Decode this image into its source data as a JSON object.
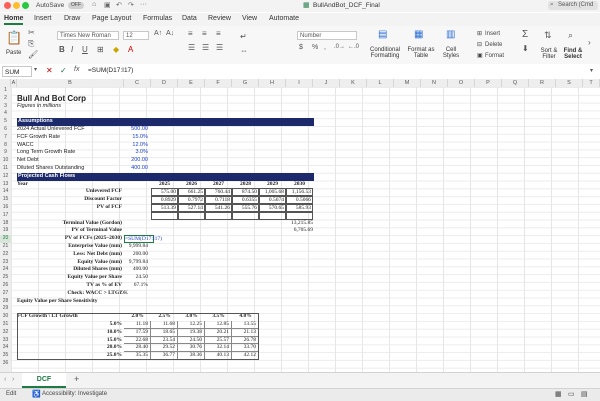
{
  "titlebar": {
    "autosave": "AutoSave",
    "autosave_state": "OFF",
    "filename": "BullAndBot_DCF_Final",
    "search": "Search (Cmd"
  },
  "tabs": [
    "Home",
    "Insert",
    "Draw",
    "Page Layout",
    "Formulas",
    "Data",
    "Review",
    "View",
    "Automate"
  ],
  "ribbon": {
    "paste": "Paste",
    "font_name": "Times New Roman",
    "font_size": "12",
    "number_format": "Number",
    "conditional_formatting": "Conditional Formatting",
    "format_as_table": "Format as Table",
    "cell_styles": "Cell Styles",
    "insert": "Insert",
    "delete": "Delete",
    "format": "Format",
    "sort_filter": "Sort & Filter",
    "find_select": "Find & Select"
  },
  "formula_bar": {
    "name_box": "SUM",
    "fx": "fx",
    "formula": "=SUM(D17:I17)"
  },
  "columns": [
    "A",
    "B",
    "C",
    "D",
    "E",
    "F",
    "G",
    "H",
    "I",
    "J",
    "K",
    "L",
    "M",
    "N",
    "O",
    "P",
    "Q",
    "R",
    "S",
    "T"
  ],
  "rows": [
    "1",
    "2",
    "3",
    "4",
    "5",
    "6",
    "7",
    "8",
    "9",
    "10",
    "11",
    "12",
    "13",
    "14",
    "15",
    "16",
    "17",
    "18",
    "19",
    "20",
    "21",
    "22",
    "23",
    "24",
    "25",
    "26",
    "27",
    "28",
    "29",
    "30",
    "31",
    "32",
    "33",
    "34",
    "35",
    "36"
  ],
  "sheet": {
    "title": "Bull And Bot Corp",
    "subtitle": "Figures in millions",
    "assumptions_header": "Assumptions",
    "assumptions": [
      {
        "label": "2024 Actual Unlevered FCF",
        "value": "500.00"
      },
      {
        "label": "FCF Growth Rate",
        "value": "15.0%"
      },
      {
        "label": "WACC",
        "value": "12.0%"
      },
      {
        "label": "Long Term Growth Rate",
        "value": "3.0%"
      },
      {
        "label": "Net Debt",
        "value": "200.00"
      },
      {
        "label": "Diluted Shares Outstanding",
        "value": "400.00"
      }
    ],
    "proj_header": "Projected Cash Flows",
    "year_label": "Year",
    "years": [
      "2025",
      "2026",
      "2027",
      "2028",
      "2029",
      "2030"
    ],
    "unlevered_fcf_label": "Unlevered FCF",
    "unlevered_fcf": [
      "575.00",
      "661.25",
      "760.44",
      "874.50",
      "1,005.68",
      "1,156.53"
    ],
    "discount_factor_label": "Discount Factor",
    "discount_factor": [
      "0.8929",
      "0.7972",
      "0.7118",
      "0.6355",
      "0.5674",
      "0.5066"
    ],
    "pv_fcf_label": "PV of FCF",
    "pv_fcf": [
      "513.39",
      "527.14",
      "541.26",
      "555.76",
      "570.65",
      "585.93"
    ],
    "terminal_value_label": "Terminal Value (Gordon)",
    "terminal_value": "13,215.85",
    "pv_terminal_label": "PV of Terminal Value",
    "pv_terminal": "6,705.69",
    "pv_fcfs_label": "PV of FCFs (2025–2030)",
    "pv_fcfs_formula": "=SUM(D17:I17)",
    "enterprise_value_label": "Enterprise Value (mm)",
    "enterprise_value": "9,999.84",
    "net_debt_label": "Less: Net Debt (mm)",
    "net_debt": "200.00",
    "equity_value_label": "Equity Value (mm)",
    "equity_value": "9,799.84",
    "diluted_shares_label": "Diluted Shares (mm)",
    "diluted_shares": "400.00",
    "equity_per_share_label": "Equity Value per Share",
    "equity_per_share": "24.50",
    "tv_pct_label": "TV as % of EV",
    "tv_pct": "67.1%",
    "check_label": "Check: WACC > LTG?",
    "check_value": "OK",
    "sensitivity_title": "Equity Value per Share Sensitivity",
    "sens_corner": "FCF Growth \\ LT Growth",
    "sens_cols": [
      "2.0%",
      "2.5%",
      "3.0%",
      "3.5%",
      "4.0%"
    ],
    "sens_rows": [
      {
        "g": "5.0%",
        "vals": [
          "11.18",
          "11.68",
          "12.25",
          "12.85",
          "13.55"
        ]
      },
      {
        "g": "10.0%",
        "vals": [
          "17.59",
          "18.65",
          "19.38",
          "20.21",
          "21.13"
        ]
      },
      {
        "g": "15.0%",
        "vals": [
          "22.68",
          "23.54",
          "24.50",
          "25.57",
          "26.78"
        ]
      },
      {
        "g": "20.0%",
        "vals": [
          "28.40",
          "29.52",
          "30.76",
          "32.14",
          "33.70"
        ]
      },
      {
        "g": "25.0%",
        "vals": [
          "35.35",
          "36.77",
          "38.36",
          "40.13",
          "42.12"
        ]
      }
    ]
  },
  "sheet_tab": "DCF",
  "status": {
    "mode": "Edit",
    "accessibility": "Accessibility: Investigate"
  },
  "colors": {
    "accent": "#1f7a43",
    "header_bar": "#1c2a6b",
    "input_blue": "#1a3fc7"
  }
}
